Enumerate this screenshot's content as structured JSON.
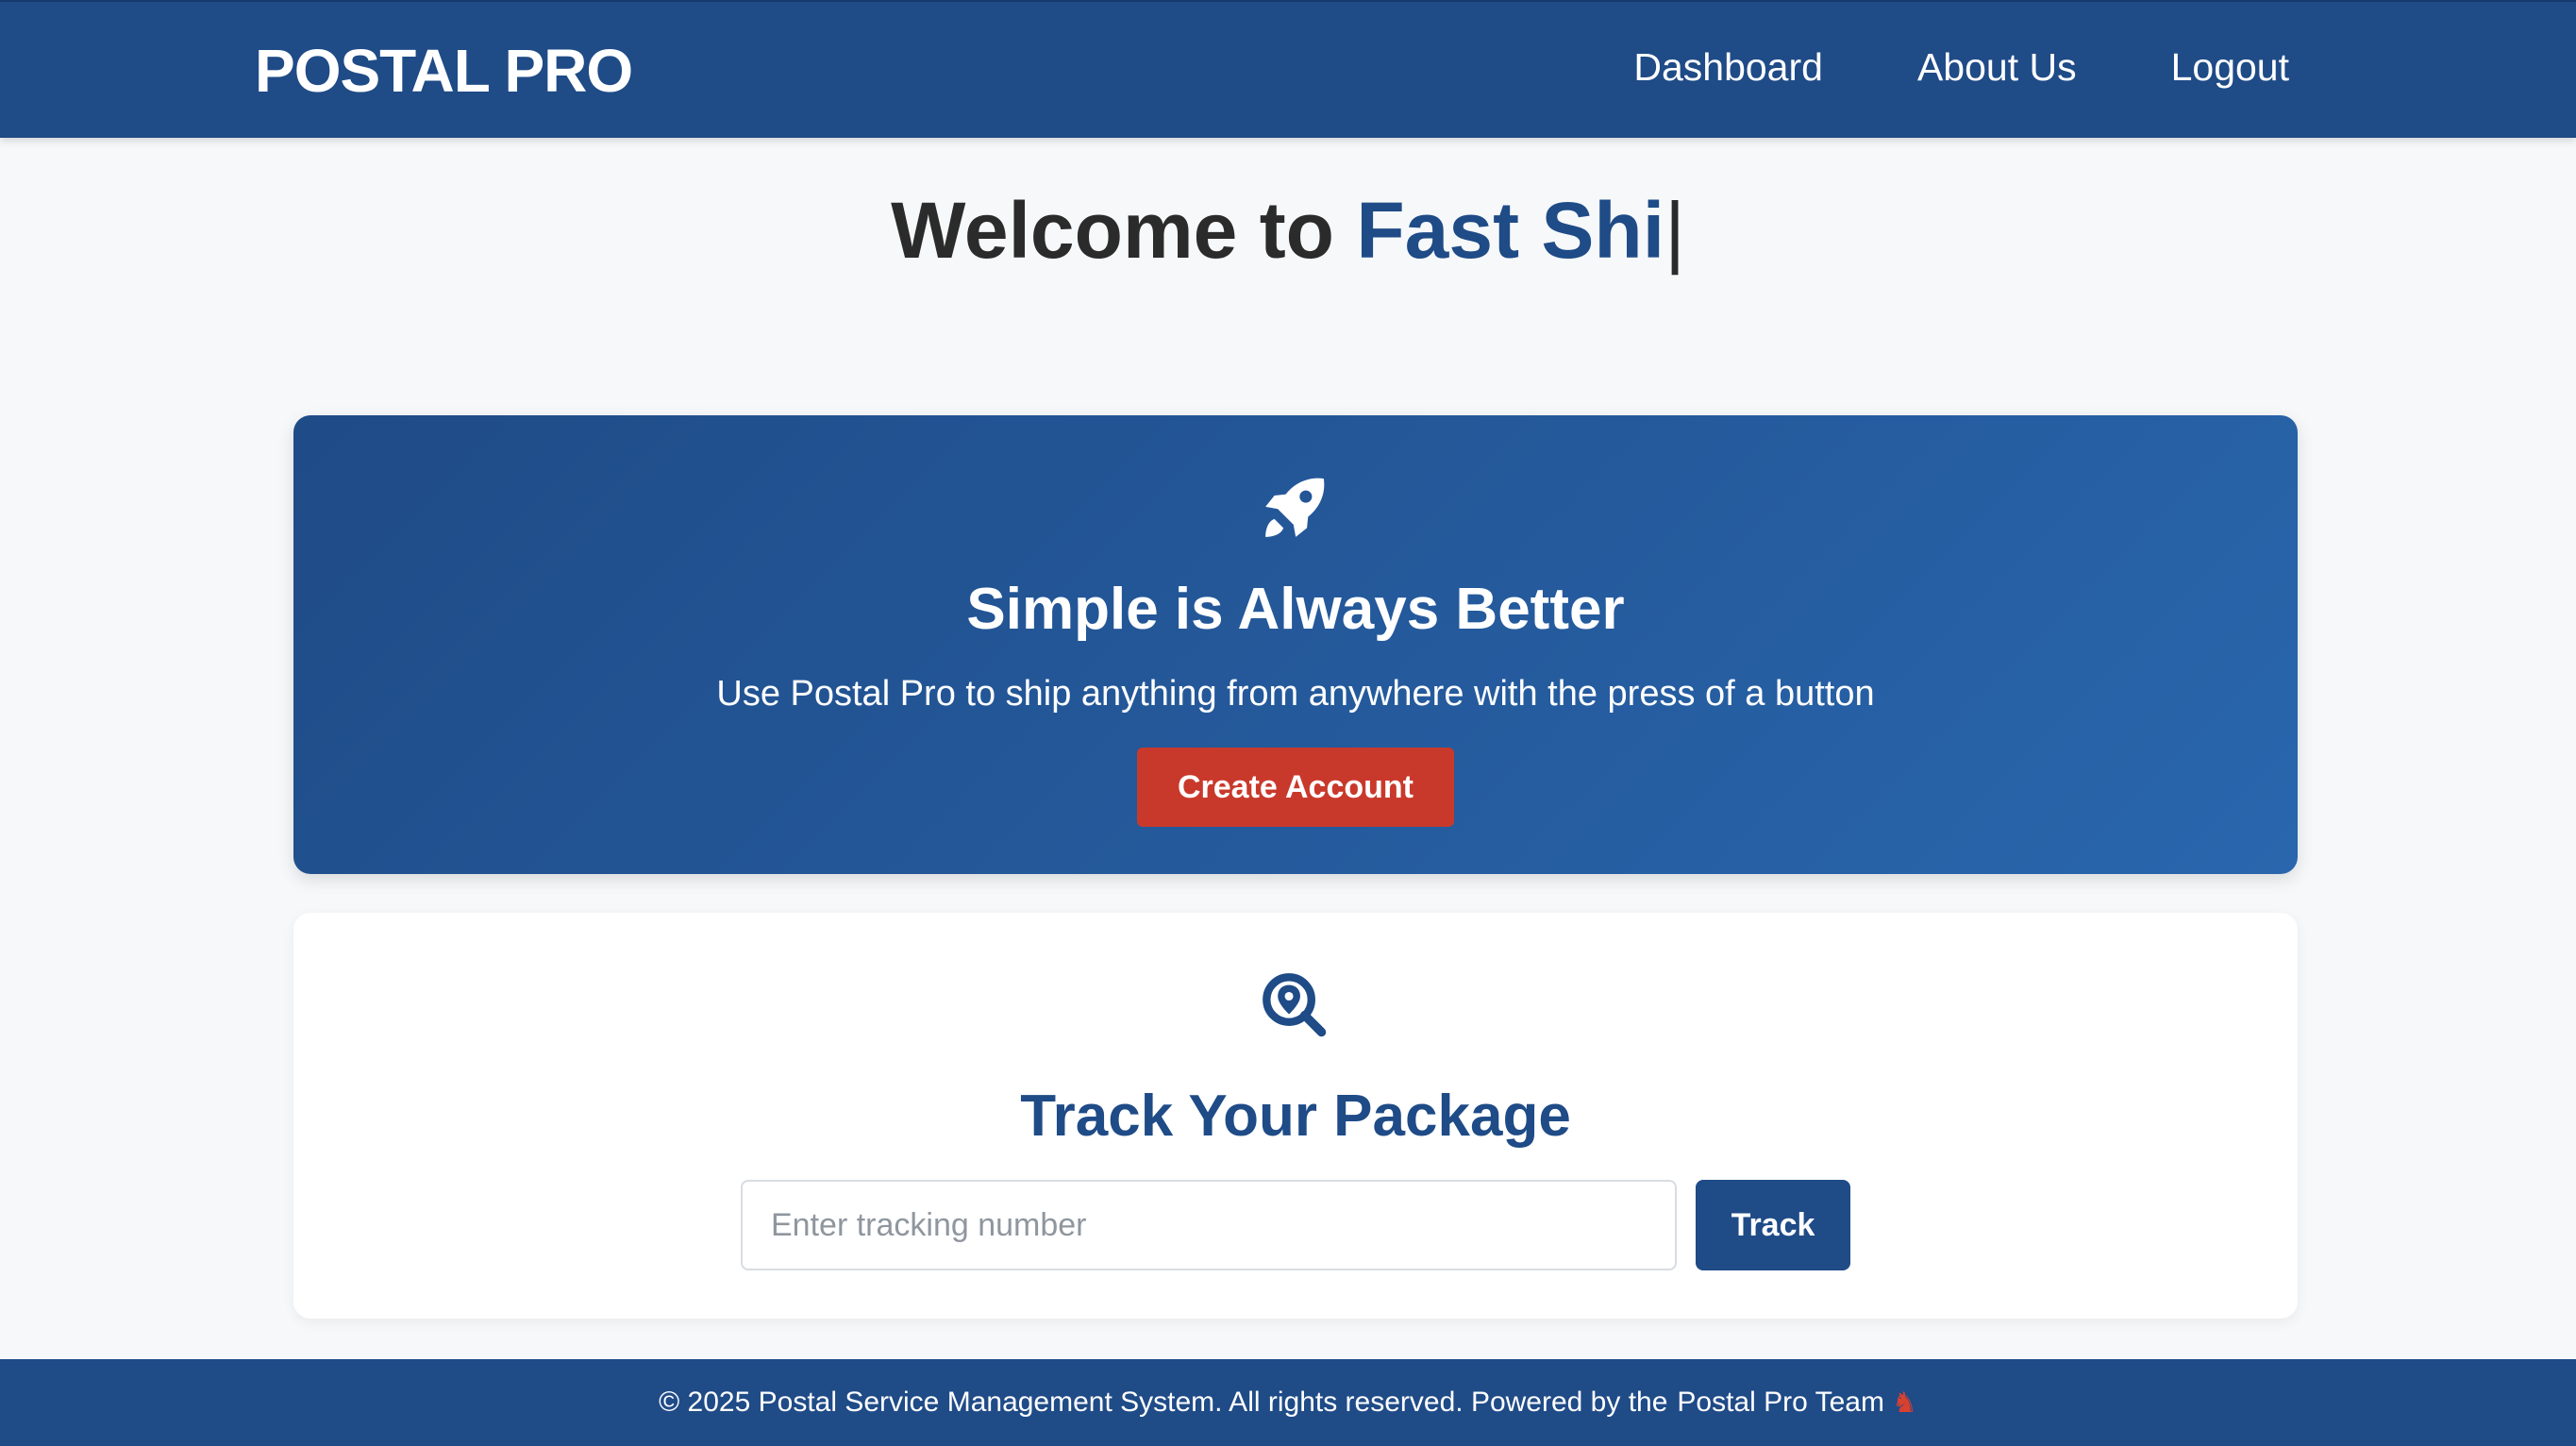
{
  "navbar": {
    "brand": "POSTAL PRO",
    "links": [
      "Dashboard",
      "About Us",
      "Logout"
    ]
  },
  "welcome": {
    "prefix": "Welcome to ",
    "highlight": "Fast Shi",
    "cursor": "|"
  },
  "hero": {
    "icon": "rocket-icon",
    "title": "Simple is Always Better",
    "subtitle": "Use Postal Pro to ship anything from anywhere with the press of a button",
    "button_label": "Create Account",
    "button_color": "#c9392b"
  },
  "tracking": {
    "icon": "location-search-icon",
    "title": "Track Your Package",
    "placeholder": "Enter tracking number",
    "value": "",
    "button_label": "Track"
  },
  "footer": {
    "text": "© 2025 Postal Service Management System. All rights reserved. Powered by the",
    "team": "Postal Pro Team",
    "team_icon": "chess-knight-icon"
  },
  "colors": {
    "primary": "#1f4b87",
    "accent_red": "#c9392b",
    "background": "#f6f8fa"
  }
}
